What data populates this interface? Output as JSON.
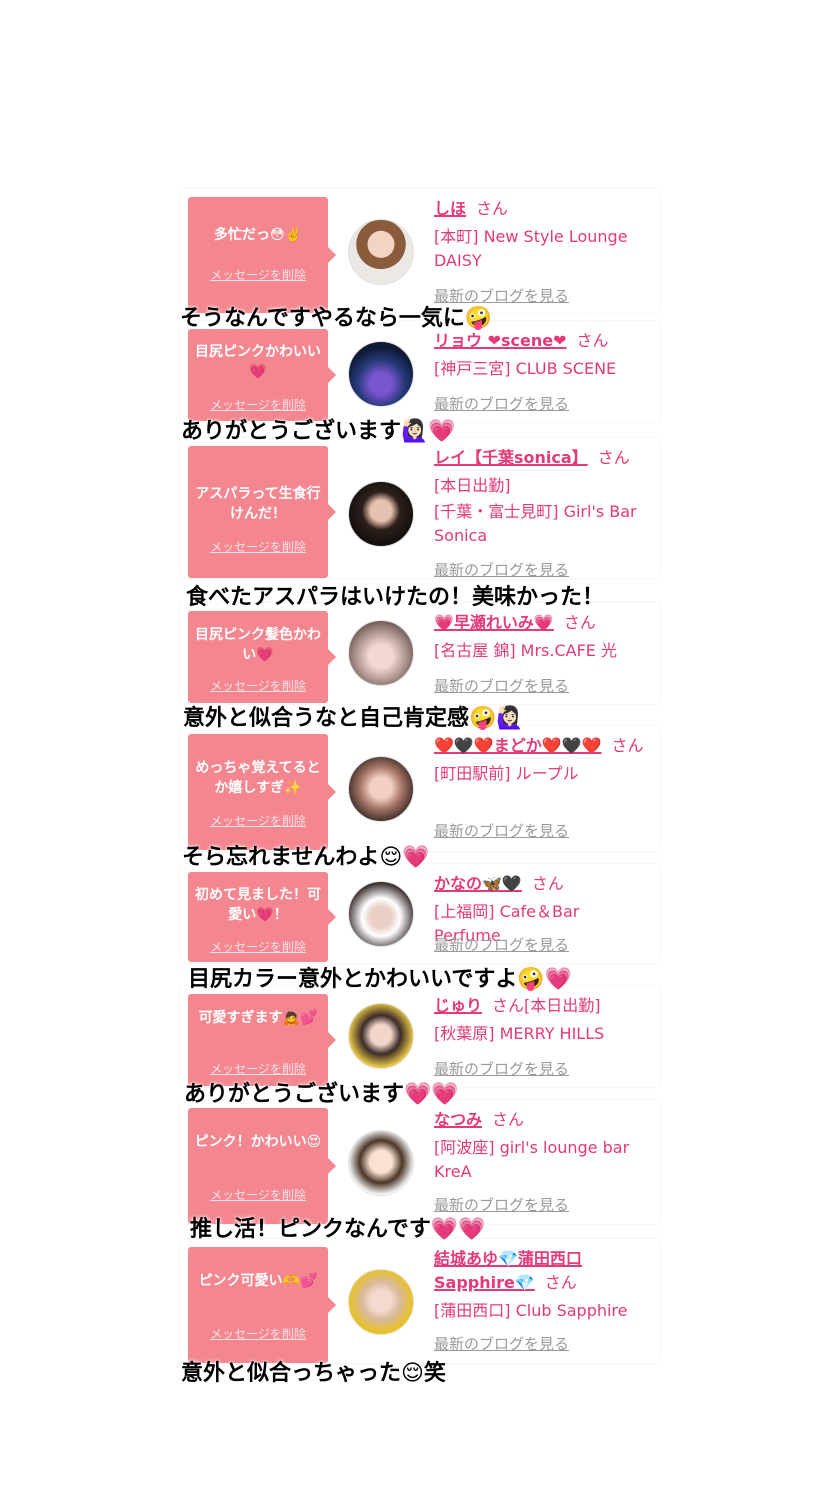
{
  "labels": {
    "delete": "メッセージを削除",
    "blog": "最新のブログを見る",
    "san": "さん"
  },
  "cards": [
    {
      "message": "多忙だっ😳✌️",
      "name": "しほ",
      "shop": [
        "[本町] New Style Lounge",
        "DAISY"
      ]
    },
    {
      "message": "目尻ピンクかわいい💗",
      "name": "リョウ ❤︎scene❤︎",
      "shop": [
        "[神戸三宮] CLUB SCENE"
      ]
    },
    {
      "message": "アスパラって生食行けんだ！",
      "name": "レイ【千葉sonica】",
      "shop": [
        "[本日出勤]",
        "[千葉・富士見町] Girl's Bar",
        "Sonica"
      ]
    },
    {
      "message": "目尻ピンク髪色かわい💗",
      "name": "💗早瀬れいみ💗",
      "shop": [
        "[名古屋 錦] Mrs.CAFE 光"
      ]
    },
    {
      "message": "めっちゃ覚えてるとか嬉しすぎ✨",
      "name": "❤️🖤❤️まどか❤️🖤❤️",
      "shop": [
        "[町田駅前] ループル"
      ]
    },
    {
      "message": "初めて見ました！可愛い💗！",
      "name": "かなの🦋🖤",
      "shop": [
        "[上福岡] Cafe＆Bar Perfume"
      ]
    },
    {
      "message": "可愛すぎます🙇💕",
      "name": "じゅり",
      "san_after": "[本日出勤]",
      "shop": [
        "[秋葉原] MERRY HILLS"
      ]
    },
    {
      "message": "ピンク！かわいい😍",
      "name": "なつみ",
      "shop": [
        "[阿波座] girl's lounge bar",
        "KreA"
      ]
    },
    {
      "message": "ピンク可愛い🫶💕",
      "name": "結城あゆ💎蒲田西口Sapphire💎",
      "shop": [
        "[蒲田西口] Club Sapphire"
      ]
    }
  ],
  "captions": [
    "そうなんですやるなら一気に🤪",
    "ありがとうございます🙋🏻‍♀️💗",
    "食べたアスパラはいけたの！美味かった！",
    "意外と似合うなと自己肯定感🤪🙋🏻‍♀️",
    "そら忘れませんわよ😌💗",
    "目尻カラー意外とかわいいですよ🤪💗",
    "ありがとうございます💗💗",
    "推し活！ピンクなんです💗💗",
    "意外と似合っちゃった😌笑"
  ]
}
